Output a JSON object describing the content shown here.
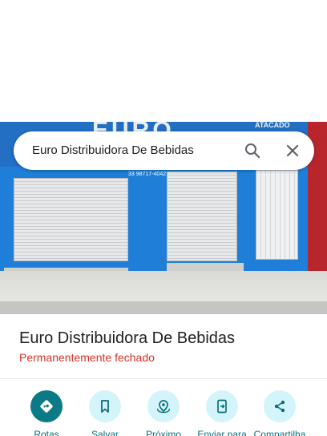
{
  "search": {
    "query": "Euro Distribuidora De Bebidas",
    "search_icon": "search-icon",
    "close_icon": "close-icon"
  },
  "photo": {
    "sign_text": "EURO",
    "sign_small": "ATACADO",
    "phone": "33 98717-4042"
  },
  "place": {
    "name": "Euro Distribuidora De Bebidas",
    "status": "Permanentemente fechado"
  },
  "actions": [
    {
      "label": "Rotas",
      "icon": "directions-icon"
    },
    {
      "label": "Salvar",
      "icon": "bookmark-icon"
    },
    {
      "label": "Próximo",
      "icon": "nearby-icon"
    },
    {
      "label": "Enviar para",
      "icon": "send-to-phone-icon"
    },
    {
      "label": "Compartilha",
      "icon": "share-icon"
    }
  ],
  "colors": {
    "accent": "#0b7a87",
    "status_closed": "#d93025",
    "action_bg": "#d4f4fb"
  }
}
